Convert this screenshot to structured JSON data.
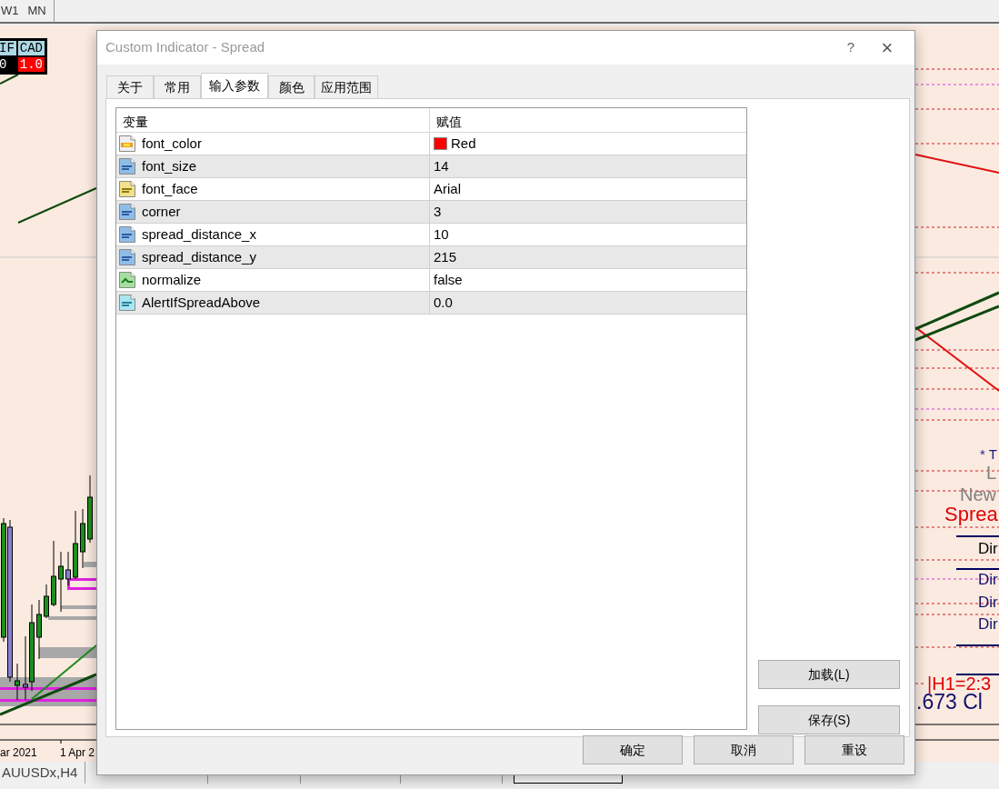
{
  "toolbar": {
    "timeframes": [
      "W1",
      "MN"
    ]
  },
  "chart": {
    "currency_table": {
      "headers": [
        "IF",
        "CAD"
      ],
      "values": [
        "0",
        "1.0"
      ]
    },
    "info_texts": [
      {
        "text": "* T",
        "kind": "note"
      },
      {
        "text": "L",
        "kind": "faded"
      },
      {
        "text": "New",
        "kind": "faded"
      },
      {
        "text": "Sprea",
        "kind": "alert"
      },
      {
        "text": "Dir",
        "kind": "label"
      },
      {
        "text": "Dir",
        "kind": "value"
      },
      {
        "text": "Dir",
        "kind": "value"
      },
      {
        "text": "Dir",
        "kind": "value"
      },
      {
        "text": "|H1=2:3",
        "kind": "timer"
      },
      {
        "text": ".673 Cl",
        "kind": "price"
      }
    ],
    "date_labels": [
      "ar 2021",
      "1 Apr 2"
    ]
  },
  "dialog": {
    "title": "Custom Indicator - Spread",
    "help": "?",
    "close": "×",
    "tabs": [
      {
        "label": "关于",
        "selected": false
      },
      {
        "label": "常用",
        "selected": false
      },
      {
        "label": "输入参数",
        "selected": true
      },
      {
        "label": "颜色",
        "selected": false
      },
      {
        "label": "应用范围",
        "selected": false
      }
    ],
    "table": {
      "columns": [
        "变量",
        "赋值"
      ],
      "rows": [
        {
          "name": "font_color",
          "kind": "color",
          "value": "Red",
          "color": "#ff0000"
        },
        {
          "name": "font_size",
          "kind": "int",
          "value": "14"
        },
        {
          "name": "font_face",
          "kind": "string",
          "value": "Arial"
        },
        {
          "name": "corner",
          "kind": "int",
          "value": "3"
        },
        {
          "name": "spread_distance_x",
          "kind": "int",
          "value": "10"
        },
        {
          "name": "spread_distance_y",
          "kind": "int",
          "value": "215"
        },
        {
          "name": "normalize",
          "kind": "bool",
          "value": "false"
        },
        {
          "name": "AlertIfSpreadAbove",
          "kind": "double",
          "value": "0.0"
        }
      ]
    },
    "side_buttons": [
      "加载(L)",
      "保存(S)"
    ],
    "buttons": [
      "确定",
      "取消",
      "重设"
    ]
  },
  "symbol_tabs": [
    {
      "label": "AUUSDx,H4",
      "selected": false
    }
  ]
}
